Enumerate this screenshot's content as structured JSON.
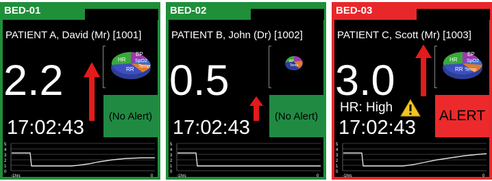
{
  "beds": [
    {
      "bed": "BED-01",
      "patient": "PATIENT A, David (Mr) [1001]",
      "score": "2.2",
      "time": "17:02:43",
      "alert": "(No Alert)",
      "alert_state": "normal",
      "hr_status": ""
    },
    {
      "bed": "BED-02",
      "patient": "PATIENT B, John (Dr) [1002]",
      "score": "0.5",
      "time": "17:02:43",
      "alert": "(No Alert)",
      "alert_state": "normal",
      "hr_status": ""
    },
    {
      "bed": "BED-03",
      "patient": "PATIENT C, Scott (Mr) [1003]",
      "score": "3.0",
      "time": "17:02:43",
      "alert": "ALERT",
      "alert_state": "alert",
      "hr_status": "HR: High"
    }
  ],
  "pie_labels": {
    "hr": "HR",
    "bp": "BP",
    "spo2": "SpO2",
    "rr": "RR",
    "temp": "Temp"
  },
  "trend": {
    "y_ticks": [
      "5",
      "4",
      "3",
      "2",
      "1",
      "0"
    ],
    "x_start": "-1hrs",
    "x_end": "0"
  },
  "colors": {
    "normal_frame": "#1f8f3a",
    "alert_frame": "#e8272a",
    "alert_button_normal": "#208a43",
    "alert_button_alert": "#ec2a2c",
    "arrow": "#e31b1b"
  }
}
